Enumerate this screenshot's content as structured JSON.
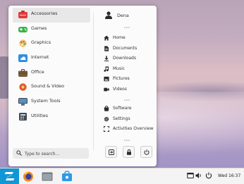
{
  "menu": {
    "categories": [
      {
        "label": "Accessories",
        "icon": "accessories-icon",
        "color": "#e23c3c",
        "selected": true
      },
      {
        "label": "Games",
        "icon": "games-icon",
        "color": "#3bb14a"
      },
      {
        "label": "Graphics",
        "icon": "graphics-icon",
        "color": "#f0a020"
      },
      {
        "label": "Internet",
        "icon": "internet-icon",
        "color": "#2f8fe0"
      },
      {
        "label": "Office",
        "icon": "office-icon",
        "color": "#7a5a3a"
      },
      {
        "label": "Sound & Video",
        "icon": "sound-video-icon",
        "color": "#e15a2a"
      },
      {
        "label": "System Tools",
        "icon": "system-tools-icon",
        "color": "#3a4450"
      },
      {
        "label": "Utilities",
        "icon": "utilities-icon",
        "color": "#3f4a58"
      }
    ],
    "search_placeholder": "Type to search...",
    "user": {
      "name": "Dena"
    },
    "places": [
      {
        "label": "Home",
        "icon": "home-icon"
      },
      {
        "label": "Documents",
        "icon": "documents-icon"
      },
      {
        "label": "Downloads",
        "icon": "downloads-icon"
      },
      {
        "label": "Music",
        "icon": "music-icon"
      },
      {
        "label": "Pictures",
        "icon": "pictures-icon"
      },
      {
        "label": "Videos",
        "icon": "videos-icon"
      }
    ],
    "system": [
      {
        "label": "Software",
        "icon": "software-icon"
      },
      {
        "label": "Settings",
        "icon": "settings-icon"
      },
      {
        "label": "Activities Overview",
        "icon": "activities-icon"
      }
    ],
    "actions": [
      {
        "name": "logout",
        "icon": "logout-icon"
      },
      {
        "name": "lock",
        "icon": "lock-icon"
      },
      {
        "name": "power",
        "icon": "power-icon"
      }
    ]
  },
  "taskbar": {
    "start_icon": "zorin-logo-icon",
    "apps": [
      {
        "name": "firefox",
        "icon": "firefox-icon"
      },
      {
        "name": "files",
        "icon": "files-icon"
      },
      {
        "name": "software",
        "icon": "software-store-icon"
      }
    ],
    "tray": [
      "window-icon",
      "volume-icon",
      "power-icon"
    ],
    "clock": "Wed 16:37"
  },
  "colors": {
    "accent": "#1196d6"
  }
}
